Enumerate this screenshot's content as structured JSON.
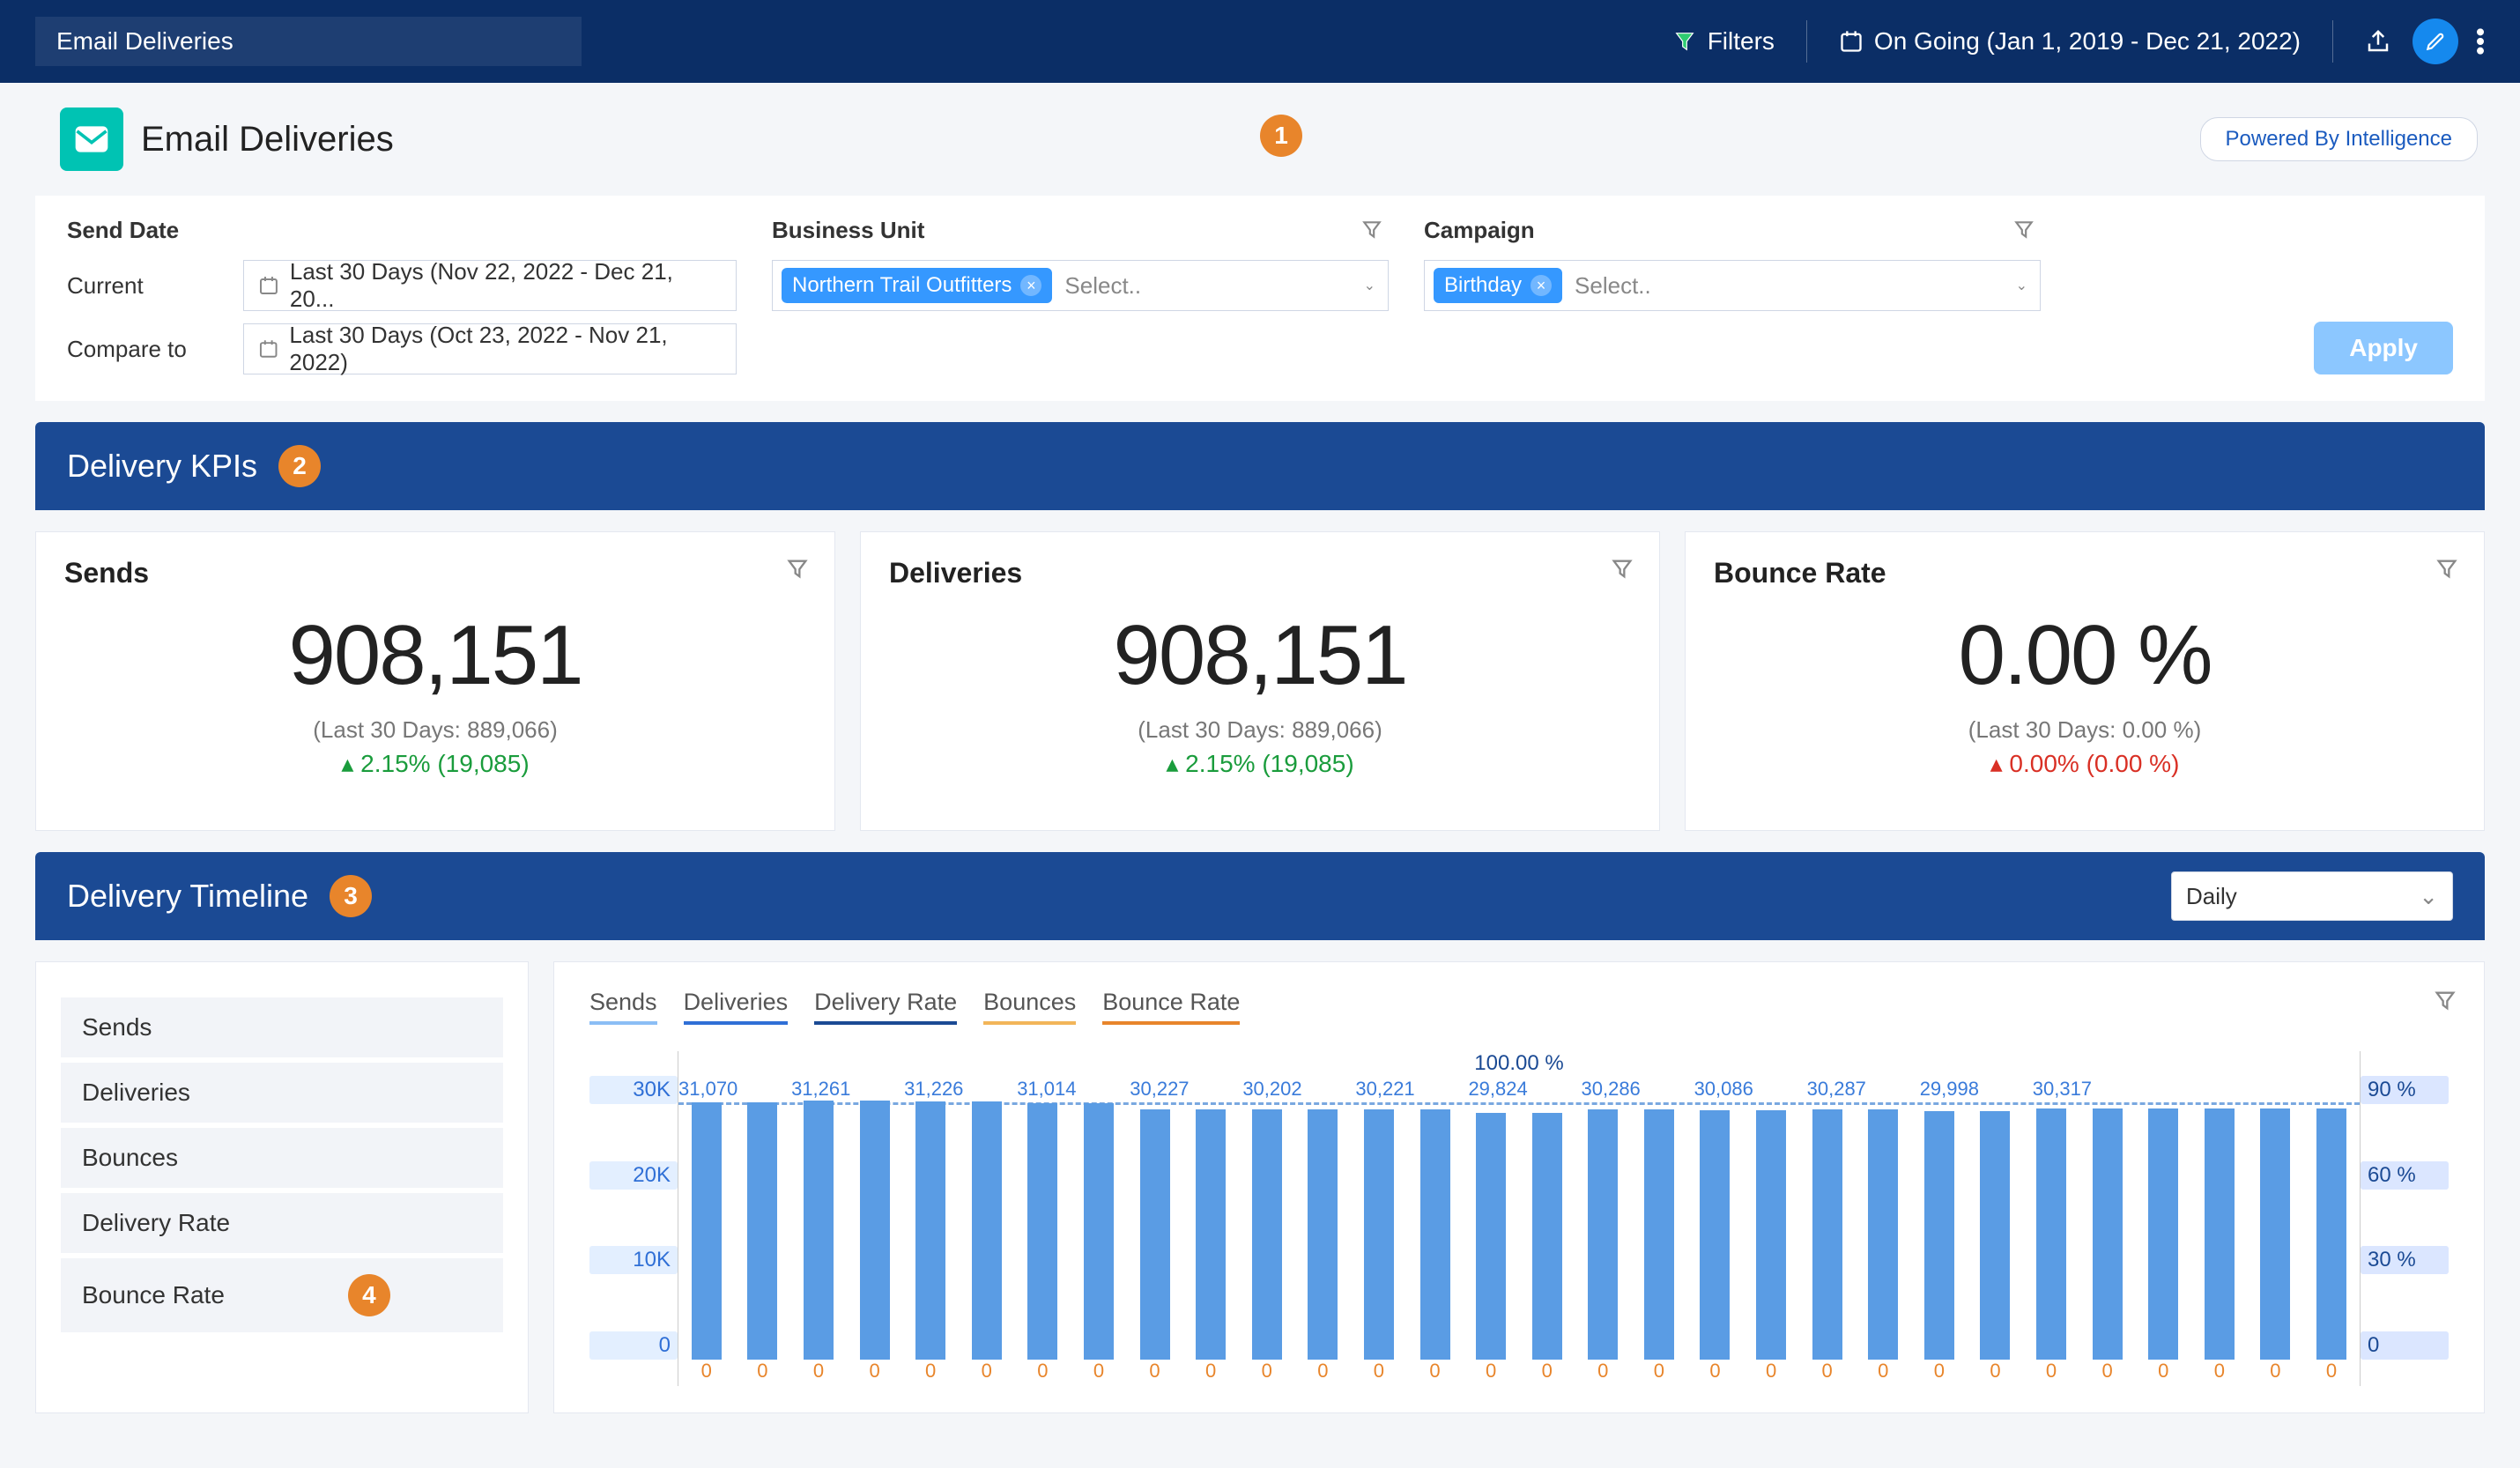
{
  "topbar": {
    "title": "Email Deliveries",
    "filters_label": "Filters",
    "date_range": "On Going (Jan 1, 2019 - Dec 21, 2022)"
  },
  "header": {
    "title": "Email Deliveries",
    "powered_label": "Powered By Intelligence",
    "marker1": "1"
  },
  "filters": {
    "send_date_label": "Send Date",
    "current_label": "Current",
    "compare_label": "Compare to",
    "current_value": "Last 30 Days (Nov 22, 2022 - Dec 21, 20...",
    "compare_value": "Last 30 Days (Oct 23, 2022 - Nov 21, 2022)",
    "bu_label": "Business Unit",
    "bu_chip": "Northern Trail Outfitters",
    "campaign_label": "Campaign",
    "campaign_chip": "Birthday",
    "select_placeholder": "Select..",
    "apply_label": "Apply"
  },
  "kpi_section": {
    "title": "Delivery KPIs",
    "marker": "2"
  },
  "kpis": [
    {
      "title": "Sends",
      "value": "908,151",
      "sub": "(Last 30 Days: 889,066)",
      "delta": "▴ 2.15% (19,085)",
      "dir": "up"
    },
    {
      "title": "Deliveries",
      "value": "908,151",
      "sub": "(Last 30 Days: 889,066)",
      "delta": "▴ 2.15% (19,085)",
      "dir": "up"
    },
    {
      "title": "Bounce Rate",
      "value": "0.00 %",
      "sub": "(Last 30 Days: 0.00 %)",
      "delta": "▴ 0.00% (0.00 %)",
      "dir": "down"
    }
  ],
  "timeline_section": {
    "title": "Delivery Timeline",
    "marker": "3",
    "granularity": "Daily"
  },
  "timeline_side": {
    "items": [
      "Sends",
      "Deliveries",
      "Bounces",
      "Delivery Rate",
      "Bounce Rate"
    ],
    "marker": "4"
  },
  "legend": {
    "sends": "Sends",
    "deliveries": "Deliveries",
    "delivery_rate": "Delivery Rate",
    "bounces": "Bounces",
    "bounce_rate": "Bounce Rate"
  },
  "chart_data": {
    "type": "bar",
    "title": "",
    "ylabel_left": "",
    "ylabel_right": "",
    "ylim_left": [
      0,
      30000
    ],
    "ylim_right": [
      0,
      100
    ],
    "y_ticks_left": [
      "30K",
      "20K",
      "10K",
      "0"
    ],
    "y_ticks_right": [
      "90 %",
      "60 %",
      "30 %",
      "0"
    ],
    "delivery_rate_label": "100.00 %",
    "series": [
      {
        "name": "Sends",
        "values": [
          31070,
          31070,
          31261,
          31261,
          31226,
          31226,
          31014,
          31014,
          30227,
          30227,
          30202,
          30202,
          30221,
          30221,
          29824,
          29824,
          30286,
          30286,
          30086,
          30086,
          30287,
          30287,
          29998,
          29998,
          30317,
          30317,
          30317,
          30317,
          30317,
          30317
        ]
      },
      {
        "name": "Delivery Rate",
        "values": [
          100,
          100,
          100,
          100,
          100,
          100,
          100,
          100,
          100,
          100,
          100,
          100,
          100,
          100,
          100,
          100,
          100,
          100,
          100,
          100,
          100,
          100,
          100,
          100,
          100,
          100,
          100,
          100,
          100,
          100
        ]
      },
      {
        "name": "Bounces",
        "values": [
          0,
          0,
          0,
          0,
          0,
          0,
          0,
          0,
          0,
          0,
          0,
          0,
          0,
          0,
          0,
          0,
          0,
          0,
          0,
          0,
          0,
          0,
          0,
          0,
          0,
          0,
          0,
          0,
          0,
          0
        ]
      }
    ],
    "top_labels": [
      "31,070",
      "",
      "31,261",
      "",
      "31,226",
      "",
      "31,014",
      "",
      "30,227",
      "",
      "30,202",
      "",
      "30,221",
      "",
      "29,824",
      "",
      "30,286",
      "",
      "30,086",
      "",
      "30,287",
      "",
      "29,998",
      "",
      "30,317",
      "",
      "",
      "",
      "",
      ""
    ]
  }
}
